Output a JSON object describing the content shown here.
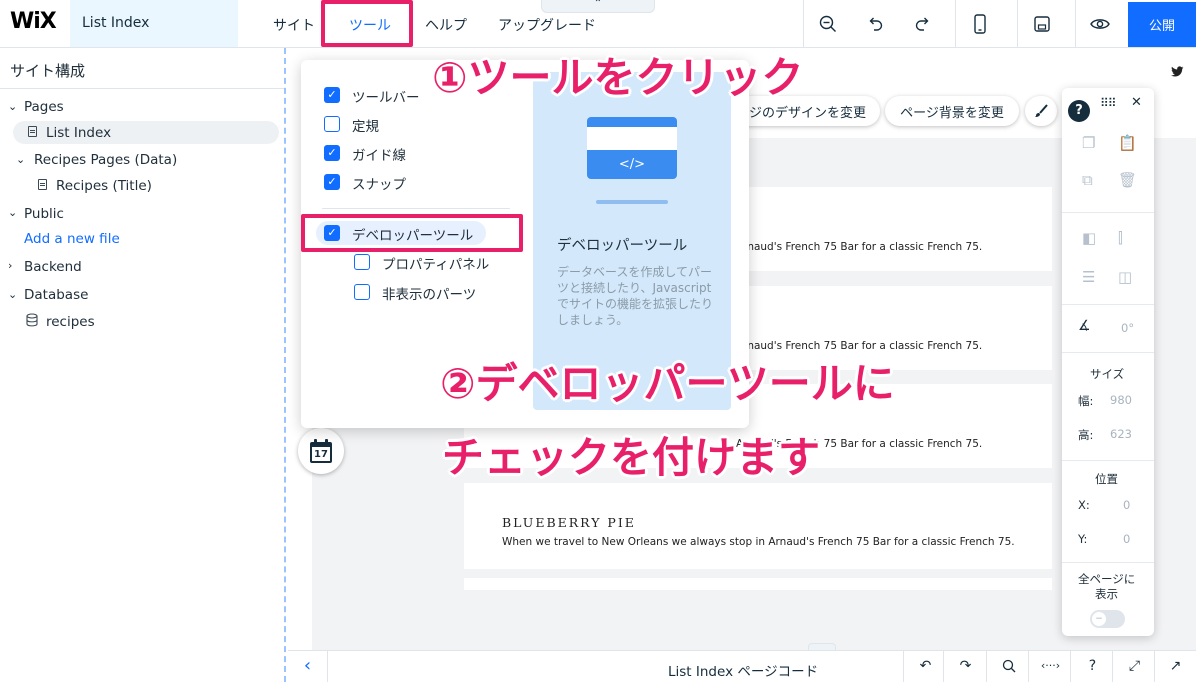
{
  "colors": {
    "accent": "#116dff",
    "annotation": "#e8206a",
    "dev_panel_bg": "#d3e9fb"
  },
  "topbar": {
    "logo": "WiX",
    "page_name": "List Index",
    "menu": {
      "site": "サイト",
      "tools": "ツール",
      "help": "ヘルプ",
      "upgrade": "アップグレード"
    },
    "collapse_icon": "chevron-up-icon",
    "buttons": [
      "zoom-out-icon",
      "undo-icon",
      "redo-icon",
      "mobile-icon",
      "save-icon",
      "preview-icon"
    ],
    "publish": "公開"
  },
  "sidebar": {
    "title": "サイト構成",
    "tree": {
      "pages": "Pages",
      "list_index": "List Index",
      "recipes_pages": "Recipes Pages (Data)",
      "recipes_title": "Recipes (Title)",
      "public": "Public",
      "add_file": "Add a new file",
      "backend": "Backend",
      "database": "Database",
      "recipes": "recipes"
    }
  },
  "canvas": {
    "pill_design": "ジのデザインを変更",
    "pill_background": "ページ背景を変更",
    "card_desc": "Arnaud's French 75 Bar for a classic French 75.",
    "card_partial_title": "BLUEBERRY PIE",
    "card_full_desc": "When we travel to New Orleans we always stop in Arnaud's French 75 Bar for a classic French 75.",
    "calendar_day": "17"
  },
  "tools_menu": {
    "toolbar": "ツールバー",
    "rulers": "定規",
    "guides": "ガイド線",
    "snap": "スナップ",
    "dev_tools": "デベロッパーツール",
    "properties_panel": "プロパティパネル",
    "hidden_parts": "非表示のパーツ",
    "dev_panel": {
      "title": "デベロッパーツール",
      "description": "データベースを作成してパーツと接続したり、Javascript でサイトの機能を拡張したりしましょう。",
      "code_glyph": "</>"
    }
  },
  "right_panel": {
    "rotation": "0°",
    "size_label": "サイズ",
    "width_label": "幅:",
    "width_value": "980",
    "height_label": "高:",
    "height_value": "623",
    "position_label": "位置",
    "x_label": "X:",
    "x_value": "0",
    "y_label": "Y:",
    "y_value": "0",
    "show_all_line1": "全ページに",
    "show_all_line2": "表示"
  },
  "bottombar": {
    "title": "List Index ページコード"
  },
  "annotations": {
    "step1": "①ツールをクリック",
    "step2": "②デベロッパーツールに",
    "step3": "チェックを付けます"
  }
}
